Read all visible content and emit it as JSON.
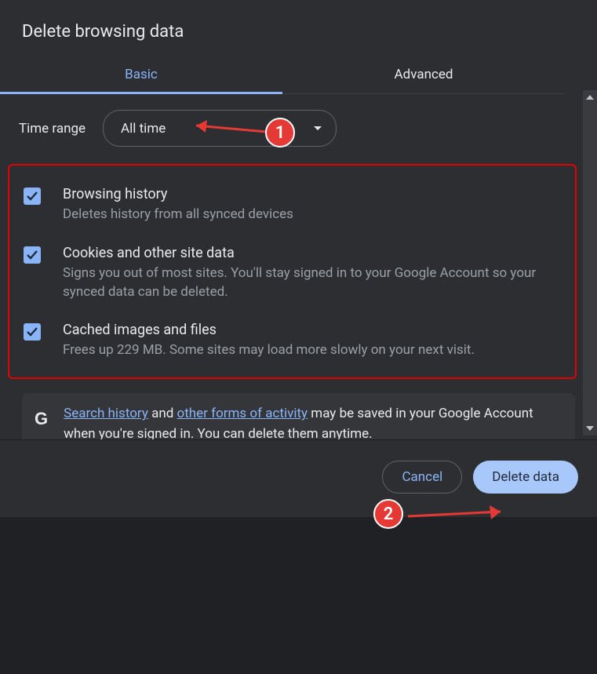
{
  "title": "Delete browsing data",
  "tabs": {
    "basic": "Basic",
    "advanced": "Advanced"
  },
  "timeRange": {
    "label": "Time range",
    "value": "All time"
  },
  "items": [
    {
      "title": "Browsing history",
      "desc": "Deletes history from all synced devices"
    },
    {
      "title": "Cookies and other site data",
      "desc": "Signs you out of most sites. You'll stay signed in to your Google Account so your synced data can be deleted."
    },
    {
      "title": "Cached images and files",
      "desc": "Frees up 229 MB. Some sites may load more slowly on your next visit."
    }
  ],
  "google": {
    "logo": "G",
    "link1": "Search history",
    "mid1": " and ",
    "link2": "other forms of activity",
    "tail": " may be saved in your Google Account when you're signed in. You can delete them anytime."
  },
  "buttons": {
    "cancel": "Cancel",
    "delete": "Delete data"
  },
  "annotations": {
    "one": "1",
    "two": "2"
  }
}
